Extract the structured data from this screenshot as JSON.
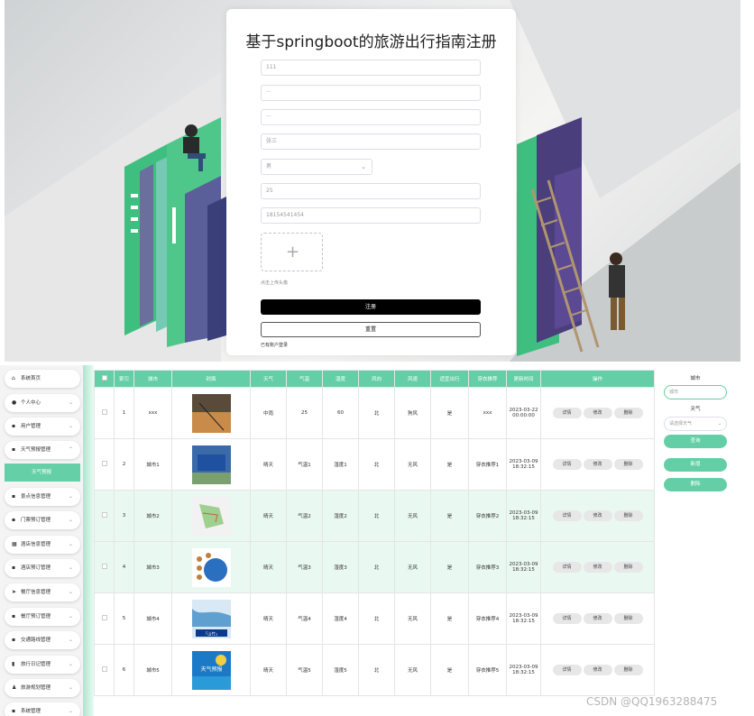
{
  "register": {
    "title": "基于springboot的旅游出行指南注册",
    "fields": [
      {
        "value": "111"
      },
      {
        "value": "···"
      },
      {
        "value": "···"
      },
      {
        "value": "张三"
      },
      {
        "value": "男"
      },
      {
        "value": "25"
      },
      {
        "value": "18154541454"
      }
    ],
    "upload_hint": "点击上传头像",
    "register_button": "注册",
    "reset_button": "重置",
    "login_link": "已有账户登录"
  },
  "sidebar": {
    "items": [
      {
        "label": "系统首页",
        "icon": "home-icon"
      },
      {
        "label": "个人中心",
        "icon": "user-icon"
      },
      {
        "label": "用户管理",
        "icon": "grid-icon"
      },
      {
        "label": "天气预报管理",
        "icon": "grid-icon"
      },
      {
        "label": "景点信息管理",
        "icon": "grid-icon"
      },
      {
        "label": "门票预订管理",
        "icon": "grid-icon"
      },
      {
        "label": "酒店信息管理",
        "icon": "building-icon"
      },
      {
        "label": "酒店预订管理",
        "icon": "grid-icon"
      },
      {
        "label": "餐厅信息管理",
        "icon": "send-icon"
      },
      {
        "label": "餐厅预订管理",
        "icon": "grid-icon"
      },
      {
        "label": "交通路线管理",
        "icon": "grid-icon"
      },
      {
        "label": "旅行日记管理",
        "icon": "book-icon"
      },
      {
        "label": "旅游规划管理",
        "icon": "person-icon"
      },
      {
        "label": "系统管理",
        "icon": "grid-icon"
      }
    ],
    "sub_active": "天气预报"
  },
  "table": {
    "headers": [
      "索引",
      "城市",
      "封面",
      "天气",
      "气温",
      "湿度",
      "风向",
      "风速",
      "适宜出行",
      "穿衣推荐",
      "更新时间",
      "操作"
    ],
    "rows": [
      {
        "idx": "1",
        "city": "xxx",
        "weather": "中雨",
        "temp": "25",
        "humidity": "60",
        "wind_dir": "北",
        "wind_speed": "狗风",
        "suitable": "是",
        "clothing": "xxx",
        "time": "2023-03-22 00:00:00"
      },
      {
        "idx": "2",
        "city": "城市1",
        "weather": "晴天",
        "temp": "气温1",
        "humidity": "湿度1",
        "wind_dir": "北",
        "wind_speed": "无风",
        "suitable": "是",
        "clothing": "穿衣推荐1",
        "time": "2023-03-09 18:32:15"
      },
      {
        "idx": "3",
        "city": "城市2",
        "weather": "晴天",
        "temp": "气温2",
        "humidity": "湿度2",
        "wind_dir": "北",
        "wind_speed": "无风",
        "suitable": "是",
        "clothing": "穿衣推荐2",
        "time": "2023-03-09 18:32:15"
      },
      {
        "idx": "4",
        "city": "城市3",
        "weather": "晴天",
        "temp": "气温3",
        "humidity": "湿度3",
        "wind_dir": "北",
        "wind_speed": "无风",
        "suitable": "是",
        "clothing": "穿衣推荐3",
        "time": "2023-03-09 18:32:15"
      },
      {
        "idx": "5",
        "city": "城市4",
        "weather": "晴天",
        "temp": "气温4",
        "humidity": "湿度4",
        "wind_dir": "北",
        "wind_speed": "无风",
        "suitable": "是",
        "clothing": "穿衣推荐4",
        "time": "2023-03-09 18:32:15"
      },
      {
        "idx": "6",
        "city": "城市5",
        "weather": "晴天",
        "temp": "气温5",
        "humidity": "湿度5",
        "wind_dir": "北",
        "wind_speed": "无风",
        "suitable": "是",
        "clothing": "穿衣推荐5",
        "time": "2023-03-09 18:32:15"
      }
    ],
    "op_detail": "详情",
    "op_edit": "修改",
    "op_delete": "删除",
    "thumb_text_5": "「山竹」",
    "thumb_text_6": "天气预报"
  },
  "filter": {
    "city_label": "城市",
    "city_placeholder": "城市",
    "weather_label": "天气",
    "weather_placeholder": "请选择天气",
    "search_button": "查询",
    "add_button": "新增",
    "delete_button": "删除"
  },
  "watermark": "CSDN @QQ1963288475",
  "colors": {
    "accent": "#64cfa6",
    "register_button": "#000000"
  }
}
